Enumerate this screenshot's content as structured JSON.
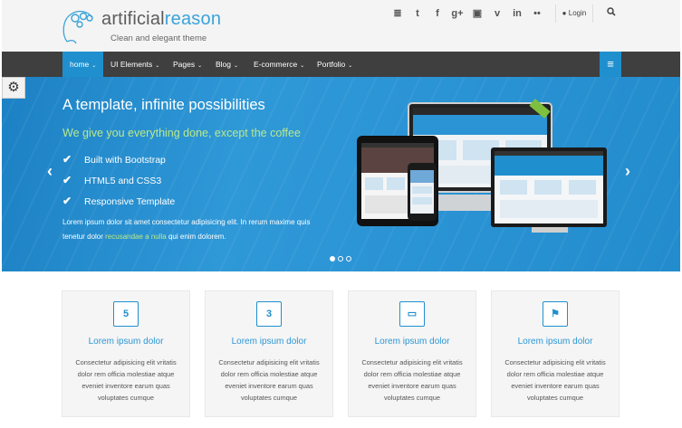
{
  "brand": {
    "name_part1": "artificial",
    "name_part2": "reason",
    "tagline": "Clean and elegant theme",
    "logo_icon": "gears-head-icon"
  },
  "topbar": {
    "social_icons": [
      {
        "name": "rss-icon",
        "glyph": "≣"
      },
      {
        "name": "twitter-icon",
        "glyph": "t"
      },
      {
        "name": "facebook-icon",
        "glyph": "f"
      },
      {
        "name": "google-plus-icon",
        "glyph": "g+"
      },
      {
        "name": "instagram-icon",
        "glyph": "▣"
      },
      {
        "name": "vine-icon",
        "glyph": "v"
      },
      {
        "name": "linkedin-icon",
        "glyph": "in"
      },
      {
        "name": "flickr-icon",
        "glyph": "••"
      }
    ],
    "login_label": "Login",
    "search_icon": "search-icon"
  },
  "nav": {
    "items": [
      {
        "label": "home",
        "active": true
      },
      {
        "label": "UI Elements",
        "active": false
      },
      {
        "label": "Pages",
        "active": false
      },
      {
        "label": "Blog",
        "active": false
      },
      {
        "label": "E-commerce",
        "active": false
      },
      {
        "label": "Portfolio",
        "active": false
      }
    ],
    "caret": "⌄",
    "menu_icon": "≡"
  },
  "hero": {
    "title": "A template, infinite possibilities",
    "subtitle": "We give you everything done, except the coffee",
    "features": [
      "Built with Bootstrap",
      "HTML5 and CSS3",
      "Responsive Template"
    ],
    "desc_before": "Lorem ipsum dolor sit amet consectetur adipisicing elit. In rerum maxime quis tenetur dolor ",
    "desc_highlight": "recusandae a nulla",
    "desc_after": " qui enim dolorem.",
    "prev_arrow": "‹",
    "next_arrow": "›",
    "slides_total": 3,
    "slide_active": 1
  },
  "cards": [
    {
      "icon": "html5-icon",
      "glyph": "5",
      "title": "Lorem ipsum dolor",
      "text": "Consectetur adipisicing elit vritatis dolor rem officia molestiae atque eveniet inventore earum quas voluptates cumque"
    },
    {
      "icon": "css3-icon",
      "glyph": "3",
      "title": "Lorem ipsum dolor",
      "text": "Consectetur adipisicing elit vritatis dolor rem officia molestiae atque eveniet inventore earum quas voluptates cumque"
    },
    {
      "icon": "desktop-icon",
      "glyph": "▭",
      "title": "Lorem ipsum dolor",
      "text": "Consectetur adipisicing elit vritatis dolor rem officia molestiae atque eveniet inventore earum quas voluptates cumque"
    },
    {
      "icon": "flag-icon",
      "glyph": "⚑",
      "title": "Lorem ipsum dolor",
      "text": "Consectetur adipisicing elit vritatis dolor rem officia molestiae atque eveniet inventore earum quas voluptates cumque"
    }
  ],
  "colors": {
    "accent": "#1f8fce",
    "nav_bg": "#3f3f3f",
    "highlight": "#b9e88a"
  }
}
